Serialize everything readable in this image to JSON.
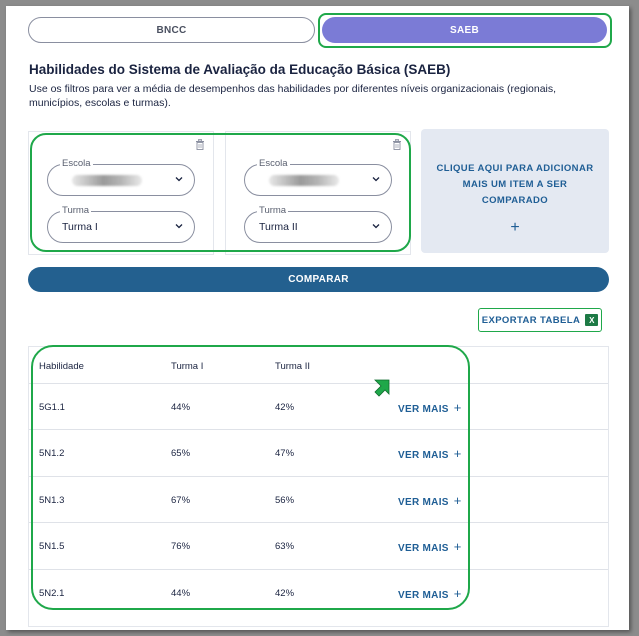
{
  "tabs": {
    "bncc": "BNCC",
    "saeb": "SAEB"
  },
  "heading": "Habilidades do Sistema de Avaliação da Educação Básica (SAEB)",
  "description": "Use os filtros para ver a média de desempenhos das habilidades por diferentes níveis organizacionais (regionais, municípios, escolas e turmas).",
  "filters": [
    {
      "escola_label": "Escola",
      "turma_label": "Turma",
      "turma_value": "Turma I"
    },
    {
      "escola_label": "Escola",
      "turma_label": "Turma",
      "turma_value": "Turma II"
    }
  ],
  "add_item": {
    "text": "CLIQUE AQUI PARA ADICIONAR MAIS UM ITEM A SER COMPARADO",
    "plus": "+"
  },
  "compare_button": "COMPARAR",
  "export_button": "EXPORTAR TABELA",
  "export_icon": "excel-icon",
  "table": {
    "headers": [
      "Habilidade",
      "Turma I",
      "Turma II"
    ],
    "rows": [
      {
        "habilidade": "5G1.1",
        "turma1": "44%",
        "turma2": "42%"
      },
      {
        "habilidade": "5N1.2",
        "turma1": "65%",
        "turma2": "47%"
      },
      {
        "habilidade": "5N1.3",
        "turma1": "67%",
        "turma2": "56%"
      },
      {
        "habilidade": "5N1.5",
        "turma1": "76%",
        "turma2": "63%"
      },
      {
        "habilidade": "5N2.1",
        "turma1": "44%",
        "turma2": "42%"
      }
    ],
    "ver_mais": "VER MAIS",
    "ver_mais_plus": "+"
  },
  "colors": {
    "accent": "#7b7bd6",
    "primary": "#23608f",
    "highlight": "#1fa84a"
  }
}
